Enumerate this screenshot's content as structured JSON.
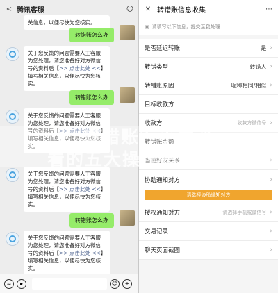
{
  "left": {
    "header": {
      "title": "腾讯客服",
      "back_icon": "chevron-left",
      "more_icon": "dots"
    },
    "bot_message": "关于您反馈的问题需要人工客服为您处理，请您准备好对方微信号的资料后【>> 点击此处 <<】填写相关信息，以便尽快为您核实。",
    "bot_message_prefix": "关于您反馈的问题需要人工客服为您处理，请您准备好对方微信号的资料后【",
    "bot_message_link": ">> 点击此处 <<",
    "bot_message_suffix": "】填写相关信息，以便尽快为您核实。",
    "top_partial_text": "关信息，以便尽快为您核实。",
    "user_message": "转错账怎么办",
    "footer": {
      "voice_icon": "voice",
      "emoji_icon": "emoji",
      "add_icon": "plus"
    }
  },
  "right": {
    "header": {
      "title": "转错账信息收集",
      "close_icon": "x",
      "more_icon": "dots"
    },
    "notice": "请填写以下信息，提交至我处理",
    "rows": [
      {
        "label": "是否延迟转账",
        "value": "是",
        "arrow": true
      },
      {
        "label": "转错类型",
        "value": "转错人",
        "arrow": true
      },
      {
        "label": "转错账原因",
        "value": "昵称相同/相似",
        "arrow": true
      },
      {
        "label": "目标收款方",
        "value": "",
        "arrow": false
      },
      {
        "label": "收款方",
        "value": "",
        "placeholder": "收款方微信号",
        "arrow": true
      },
      {
        "label": "转错账金额",
        "value": "",
        "arrow": false
      },
      {
        "label": "当前好友关系",
        "value": "",
        "arrow": true
      },
      {
        "label": "协助通知对方",
        "value": "",
        "arrow": true
      }
    ],
    "notify_button": "请选择协助通知对方",
    "rows2": [
      {
        "label": "授权通知对方",
        "value": "",
        "placeholder": "请选择手机或微信号",
        "arrow": true
      },
      {
        "label": "交易记录",
        "value": "",
        "arrow": true
      },
      {
        "label": "聊天页面截图",
        "value": "",
        "arrow": true
      }
    ]
  },
  "watermark": {
    "line1": "转错账？小白必",
    "line2": "看的五大操作指"
  }
}
